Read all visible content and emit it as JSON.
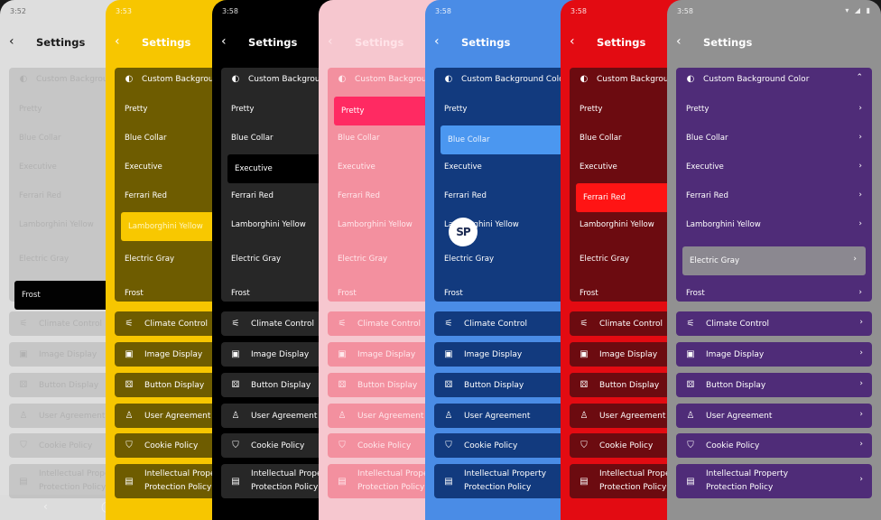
{
  "phones": [
    {
      "status_time": "3:52",
      "status_icons": "",
      "bg": "#f4f4f4",
      "fg": "#1a1a1a",
      "card": "#d9d9d9",
      "card_fg": "#c2c2c2",
      "sel_bg": "#000000",
      "sel_fg": "#ffffff",
      "opacity": 0.9,
      "title": "Settings",
      "selected_index": 6
    },
    {
      "status_time": "3:53",
      "status_icons": "◉ ◉ ◉ ●",
      "bg": "#f7c600",
      "fg": "#ffffff",
      "card": "#6e5c00",
      "card_fg": "#ffffff",
      "sel_bg": "#f8c800",
      "sel_fg": "#fff7c0",
      "opacity": 1,
      "title": "Settings",
      "selected_index": 4
    },
    {
      "status_time": "3:58",
      "status_icons": "",
      "bg": "#000000",
      "fg": "#ffffff",
      "card": "#272727",
      "card_fg": "#ffffff",
      "sel_bg": "#000000",
      "sel_fg": "#ffffff",
      "opacity": 1,
      "title": "Settings",
      "selected_index": 2
    },
    {
      "status_time": "",
      "status_icons": "",
      "bg": "#f6c7cf",
      "fg": "#ffe3e8",
      "card": "#f3909f",
      "card_fg": "#ffe8ec",
      "sel_bg": "#ff2a62",
      "sel_fg": "#ffffff",
      "opacity": 1,
      "title": "Settings",
      "selected_index": 0
    },
    {
      "status_time": "3:58",
      "status_icons": "",
      "bg": "#4a8ce6",
      "fg": "#ffffff",
      "card": "#123a7e",
      "card_fg": "#ffffff",
      "sel_bg": "#4b97f0",
      "sel_fg": "#e8f2ff",
      "opacity": 1,
      "title": "Settings",
      "selected_index": 1
    },
    {
      "status_time": "3:58",
      "status_icons": "",
      "bg": "#e30b12",
      "fg": "#ffffff",
      "card": "#6c0b10",
      "card_fg": "#ffffff",
      "sel_bg": "#ff1414",
      "sel_fg": "#ffffff",
      "opacity": 1,
      "title": "Settings",
      "selected_index": 3
    },
    {
      "status_time": "3:58",
      "status_icons": "▾ ◢ ▮",
      "bg": "#919191",
      "fg": "#ffffff",
      "card": "#4f2c78",
      "card_fg": "#ffffff",
      "sel_bg": "#8b8890",
      "sel_fg": "#ffffff",
      "opacity": 1,
      "title": "Settings",
      "selected_index": 5
    }
  ],
  "custom_background": {
    "label": "Custom Background Color",
    "icon": "palette-icon",
    "options": [
      "Pretty",
      "Blue Collar",
      "Executive",
      "Ferrari Red",
      "Lamborghini Yellow",
      "Electric Gray",
      "Frost"
    ]
  },
  "menu": [
    {
      "label": "Climate Control",
      "icon": "sliders-icon",
      "glyph": "⚟"
    },
    {
      "label": "Image Display",
      "icon": "image-icon",
      "glyph": "▣"
    },
    {
      "label": "Button Display",
      "icon": "dice-icon",
      "glyph": "⚄"
    },
    {
      "label": "User Agreement",
      "icon": "user-icon",
      "glyph": "♙"
    },
    {
      "label": "Cookie Policy",
      "icon": "shield-icon",
      "glyph": "⛉"
    },
    {
      "label": "Intellectual Property Protection Policy",
      "icon": "ip-document-icon",
      "glyph": "▤"
    }
  ],
  "watermark": "SP"
}
